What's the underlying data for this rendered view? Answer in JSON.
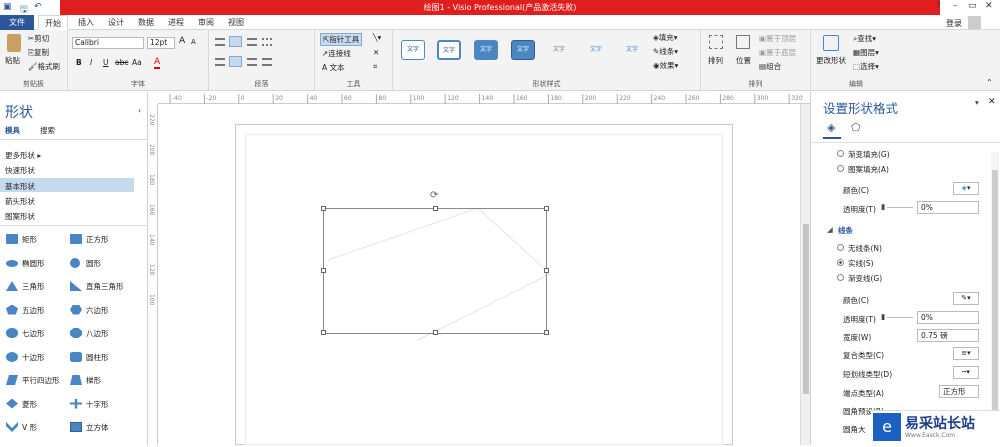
{
  "window": {
    "title": "绘图1 - Visio Professional(产品激活失败)",
    "help": "?",
    "min": "–",
    "restore": "▭",
    "close": "✕",
    "login": "登录"
  },
  "tabs": [
    "文件",
    "开始",
    "插入",
    "设计",
    "数据",
    "进程",
    "审阅",
    "视图"
  ],
  "clipboard": {
    "paste": "粘贴",
    "cut": "剪切",
    "copy": "复制",
    "format_painter": "格式刷",
    "label": "剪贴板"
  },
  "font": {
    "family": "Calibri",
    "size": "12pt",
    "bold": "B",
    "italic": "I",
    "underline": "U",
    "strike": "abc",
    "case": "Aa",
    "color": "A",
    "grow": "A",
    "shrink": "A",
    "label": "字体"
  },
  "paragraph": {
    "label": "段落"
  },
  "tools": {
    "pointer": "指针工具",
    "connector": "连接线",
    "text": "A 文本",
    "label": "工具"
  },
  "shape_styles": {
    "items": [
      "文字",
      "文字",
      "文字",
      "文字",
      "文字",
      "文字",
      "文字"
    ],
    "fill": "填充",
    "line": "线条",
    "effects": "效果",
    "label": "形状样式"
  },
  "arrange": {
    "arrange": "排列",
    "position": "位置",
    "front": "置于顶层",
    "back": "置于底层",
    "group": "组合",
    "label": "排列"
  },
  "editing": {
    "change_shape": "更改形状",
    "find": "查找",
    "layers": "图层",
    "select": "选择",
    "label": "编辑"
  },
  "shapes_pane": {
    "title": "形状",
    "tab_stencil": "模具",
    "tab_search": "搜索",
    "more": "更多形状",
    "quick": "快速形状",
    "basic": "基本形状",
    "arrows": "箭头形状",
    "patterns": "图案形状",
    "items": [
      [
        "矩形",
        "正方形"
      ],
      [
        "椭圆形",
        "圆形"
      ],
      [
        "三角形",
        "直角三角形"
      ],
      [
        "五边形",
        "六边形"
      ],
      [
        "七边形",
        "八边形"
      ],
      [
        "十边形",
        "圆柱形"
      ],
      [
        "平行四边形",
        "梯形"
      ],
      [
        "菱形",
        "十字形"
      ],
      [
        "V 形",
        "立方体"
      ]
    ]
  },
  "ruler": {
    "h": [
      "-40",
      "-20",
      "0",
      "20",
      "40",
      "60",
      "80",
      "100",
      "120",
      "140",
      "160",
      "180",
      "200",
      "220",
      "240",
      "260",
      "280",
      "300",
      "320"
    ],
    "v": [
      "220",
      "200",
      "180",
      "160",
      "140",
      "120",
      "100"
    ]
  },
  "format_pane": {
    "title": "设置形状格式",
    "gradient_fill": "渐变填充(G)",
    "pattern_fill": "图案填充(A)",
    "fill_color": "颜色(C)",
    "fill_transparency": "透明度(T)",
    "fill_transparency_value": "0%",
    "line_section": "线条",
    "no_line": "无线条(N)",
    "solid_line": "实线(S)",
    "gradient_line": "渐变线(G)",
    "line_color": "颜色(C)",
    "line_transparency": "透明度(T)",
    "line_transparency_value": "0%",
    "width": "宽度(W)",
    "width_value": "0.75 磅",
    "compound": "复合类型(C)",
    "dash": "短划线类型(D)",
    "cap": "端点类型(A)",
    "cap_value": "正方形",
    "round_preset": "圆角预设(R)",
    "round_size": "圆角大"
  },
  "watermark": {
    "text": "易采站长站",
    "sub": "Www.Easck.Com"
  }
}
